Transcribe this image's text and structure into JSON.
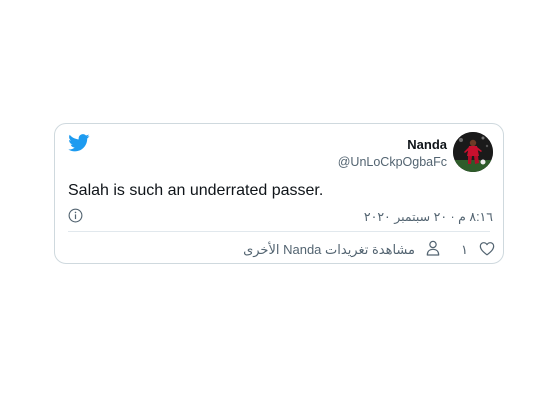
{
  "colors": {
    "brand": "#1d9bf0",
    "text_primary": "#0f1419",
    "text_secondary": "#536471",
    "border": "#cfd9de"
  },
  "tweet": {
    "logo_icon": "twitter-bird-icon",
    "author": {
      "name": "Nanda",
      "handle": "@UnLoCkpOgbaFc",
      "avatar_icon": "avatar-photo"
    },
    "text": "Salah is such an underrated passer.",
    "timestamp": "٨:١٦ م · ٢٠ سبتمبر ٢٠٢٠",
    "info_icon": "info-icon",
    "actions": {
      "like_icon": "heart-icon",
      "like_count": "١",
      "view_more_icon": "person-icon",
      "view_more_label": "مشاهدة تغريدات Nanda الأخرى"
    }
  }
}
